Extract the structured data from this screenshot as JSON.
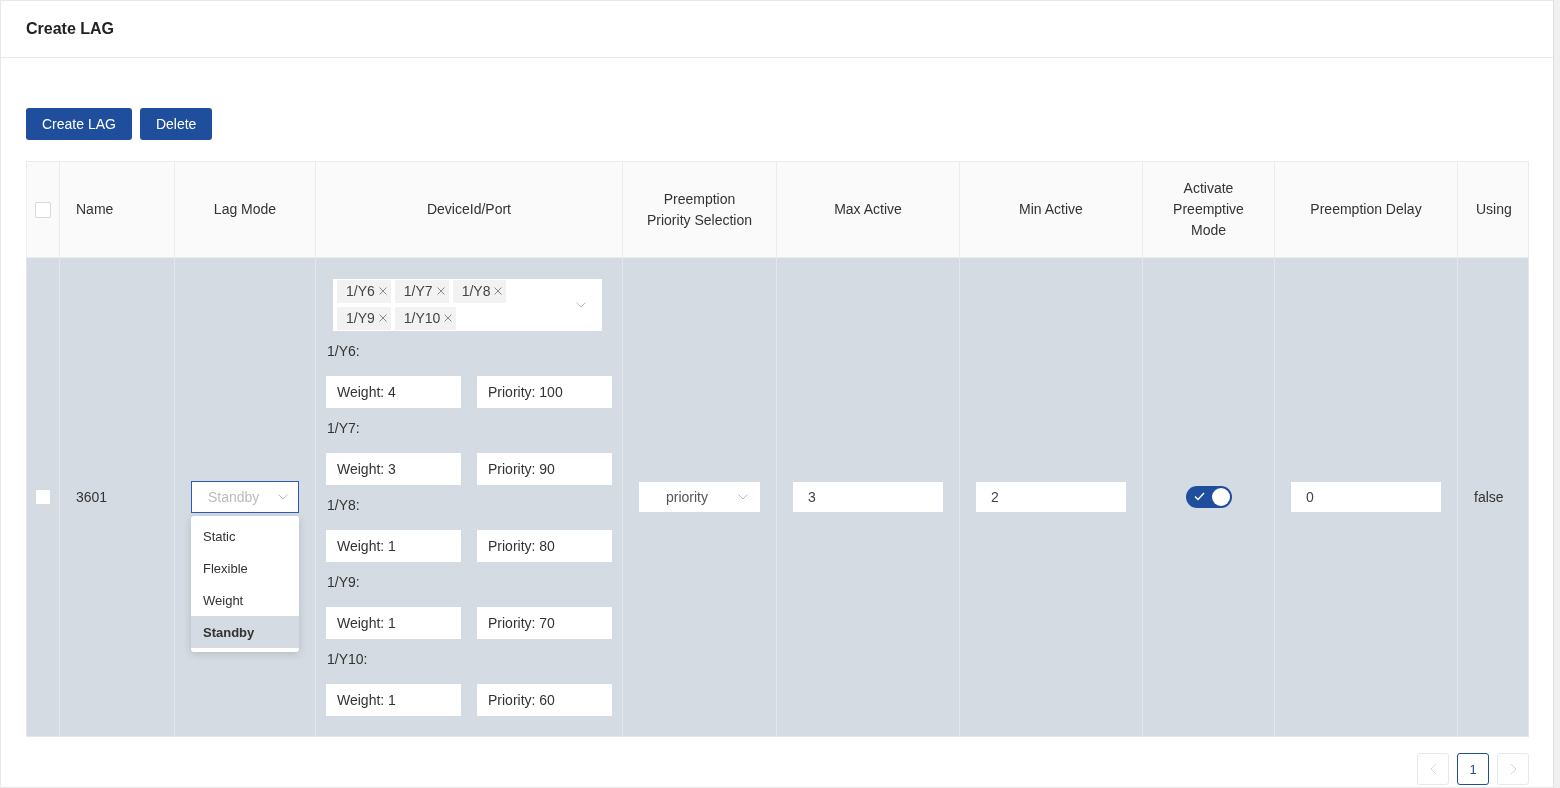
{
  "header": {
    "title": "Create LAG"
  },
  "toolbar": {
    "buttons": [
      "Create LAG",
      "Delete"
    ]
  },
  "table": {
    "select_all": {
      "checked": false
    },
    "columns": [
      "Name",
      "Lag Mode",
      "DeviceId/Port",
      "Preemption Priority Selection",
      "Max Active",
      "Min Active",
      "Activate Preemptive Mode",
      "Preemption Delay",
      "Using"
    ],
    "rows": [
      {
        "checked": false,
        "highlighted": true,
        "name": "3601",
        "lag_mode": {
          "value": "Standby",
          "open": true,
          "options": [
            {
              "label": "Static",
              "selected": false
            },
            {
              "label": "Flexible",
              "selected": false
            },
            {
              "label": "Weight",
              "selected": false
            },
            {
              "label": "Standby",
              "selected": true
            }
          ]
        },
        "ports": {
          "tags": [
            "1/Y6",
            "1/Y7",
            "1/Y8",
            "1/Y9",
            "1/Y10"
          ],
          "settings": [
            {
              "label": "1/Y6:",
              "weight": "Weight: 4",
              "priority": "Priority: 100"
            },
            {
              "label": "1/Y7:",
              "weight": "Weight: 3",
              "priority": "Priority: 90"
            },
            {
              "label": "1/Y8:",
              "weight": "Weight: 1",
              "priority": "Priority: 80"
            },
            {
              "label": "1/Y9:",
              "weight": "Weight: 1",
              "priority": "Priority: 70"
            },
            {
              "label": "1/Y10:",
              "weight": "Weight: 1",
              "priority": "Priority: 60"
            }
          ]
        },
        "preemption_priority": "priority",
        "max_active": "3",
        "min_active": "2",
        "preemptive_mode": {
          "on": true
        },
        "preemption_delay": "0",
        "using": "false"
      }
    ]
  },
  "pagination": {
    "pages": [
      {
        "label": "1",
        "selected": true
      }
    ],
    "prev_disabled": true,
    "next_disabled": true
  }
}
